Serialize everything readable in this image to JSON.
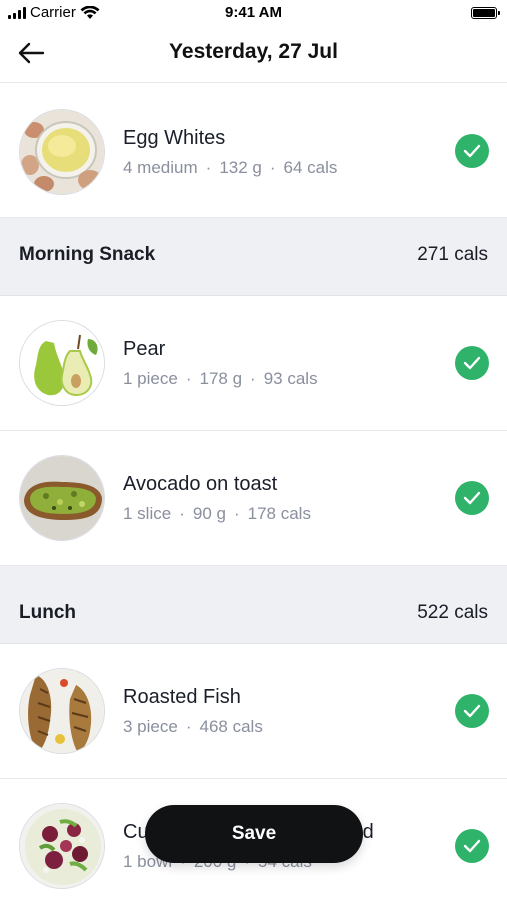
{
  "status_bar": {
    "carrier": "Carrier",
    "time": "9:41 AM"
  },
  "nav": {
    "title": "Yesterday, 27 Jul",
    "back_icon": "arrow-left-icon"
  },
  "sections": [
    {
      "items": [
        {
          "name": "Egg Whites",
          "quantity": "4 medium",
          "weight": "132 g",
          "cals": "64 cals",
          "checked": true
        }
      ]
    },
    {
      "title": "Morning Snack",
      "total": "271 cals",
      "items": [
        {
          "name": "Pear",
          "quantity": "1 piece",
          "weight": "178 g",
          "cals": "93 cals",
          "checked": true
        },
        {
          "name": "Avocado on toast",
          "quantity": "1 slice",
          "weight": "90 g",
          "cals": "178 cals",
          "checked": true
        }
      ]
    },
    {
      "title": "Lunch",
      "total": "522 cals",
      "items": [
        {
          "name": "Roasted Fish",
          "quantity": "3 piece",
          "cals": "468 cals",
          "checked": true
        },
        {
          "name": "Cu",
          "name_trailing": "d",
          "quantity": "1 bowl",
          "weight": "200 g",
          "cals": "54 cals",
          "checked": true
        }
      ]
    }
  ],
  "save_button": {
    "label": "Save"
  },
  "colors": {
    "check_green": "#2fb36a",
    "section_bg": "#eef0f3",
    "meta_gray": "#8a8f9e",
    "save_bg": "#111214"
  }
}
